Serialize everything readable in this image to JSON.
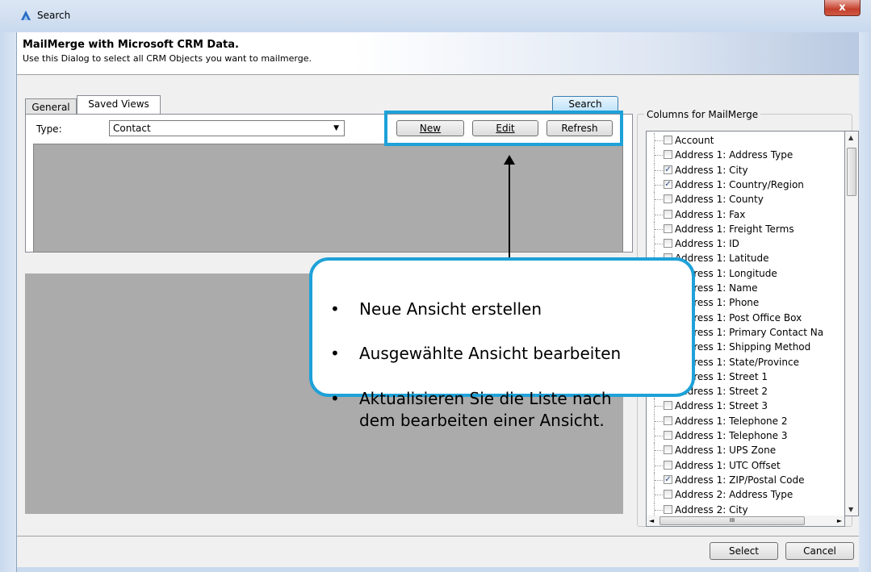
{
  "window": {
    "title": "Search",
    "close_label": "x"
  },
  "header": {
    "title": "MailMerge with Microsoft CRM Data.",
    "subtitle": "Use this Dialog to select all CRM Objects you want to mailmerge."
  },
  "tabs": [
    {
      "label": "General",
      "active": false
    },
    {
      "label": "Saved Views",
      "active": true
    }
  ],
  "saved_views": {
    "type_label": "Type:",
    "type_value": "Contact",
    "new_label": "New",
    "edit_label": "Edit",
    "refresh_label": "Refresh",
    "search_label": "Search"
  },
  "columns": {
    "legend": "Columns for MailMerge",
    "items": [
      {
        "label": "Account",
        "checked": false
      },
      {
        "label": "Address 1: Address Type",
        "checked": false
      },
      {
        "label": "Address 1: City",
        "checked": true
      },
      {
        "label": "Address 1: Country/Region",
        "checked": true
      },
      {
        "label": "Address 1: County",
        "checked": false
      },
      {
        "label": "Address 1: Fax",
        "checked": false
      },
      {
        "label": "Address 1: Freight Terms",
        "checked": false
      },
      {
        "label": "Address 1: ID",
        "checked": false
      },
      {
        "label": "Address 1: Latitude",
        "checked": false
      },
      {
        "label": "Address 1: Longitude",
        "checked": false
      },
      {
        "label": "Address 1: Name",
        "checked": false
      },
      {
        "label": "Address 1: Phone",
        "checked": false
      },
      {
        "label": "Address 1: Post Office Box",
        "checked": false
      },
      {
        "label": "Address 1: Primary Contact Na",
        "checked": false
      },
      {
        "label": "Address 1: Shipping Method",
        "checked": false
      },
      {
        "label": "Address 1: State/Province",
        "checked": false
      },
      {
        "label": "Address 1: Street 1",
        "checked": false
      },
      {
        "label": "Address 1: Street 2",
        "checked": false
      },
      {
        "label": "Address 1: Street 3",
        "checked": false
      },
      {
        "label": "Address 1: Telephone 2",
        "checked": false
      },
      {
        "label": "Address 1: Telephone 3",
        "checked": false
      },
      {
        "label": "Address 1: UPS Zone",
        "checked": false
      },
      {
        "label": "Address 1: UTC Offset",
        "checked": false
      },
      {
        "label": "Address 1: ZIP/Postal Code",
        "checked": true
      },
      {
        "label": "Address 2: Address Type",
        "checked": false
      },
      {
        "label": "Address 2: City",
        "checked": false
      }
    ]
  },
  "footer": {
    "select_label": "Select",
    "cancel_label": "Cancel"
  },
  "callout": {
    "bullets": [
      {
        "line1": "Neue Ansicht erstellen",
        "line2": ""
      },
      {
        "line1": "Ausgewählte Ansicht bearbeiten",
        "line2": ""
      },
      {
        "line1": "Aktualisieren Sie die Liste nach",
        "line2": "dem bearbeiten einer Ansicht."
      }
    ]
  }
}
